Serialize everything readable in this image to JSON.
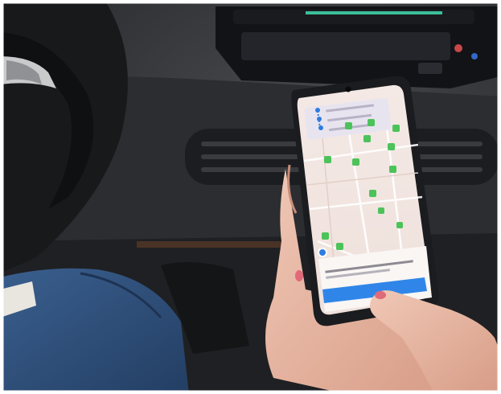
{
  "scene": {
    "description_colors": {
      "dashboard": "#2b2c2f",
      "phone_bezel": "#1b1c1f",
      "map_background": "#f1e4e0",
      "charger_marker": "#4cc35a",
      "route_blue": "#2f7be0",
      "action_button": "#2f86e8",
      "jeans": "#2f4f7a",
      "skin": "#e8b8a4"
    }
  },
  "phone_app": {
    "charging_stations_count": 13,
    "route_waypoints": 3
  }
}
